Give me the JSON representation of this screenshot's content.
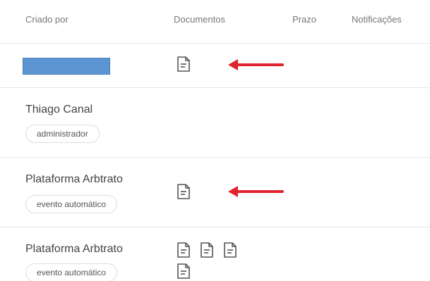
{
  "table": {
    "columns": {
      "created_by": "Criado por",
      "documents": "Documentos",
      "deadline": "Prazo",
      "notifications": "Notificações"
    },
    "rows": [
      {
        "creator": "",
        "tag": "",
        "documents": 1
      },
      {
        "creator": "Thiago Canal",
        "tag": "administrador",
        "documents": 0
      },
      {
        "creator": "Plataforma Arbtrato",
        "tag": "evento automático",
        "documents": 1
      },
      {
        "creator": "Plataforma Arbtrato",
        "tag": "evento automático",
        "documents": 4
      }
    ]
  },
  "annotations": {
    "arrow_color": "#e0242f"
  },
  "icons": {
    "document": "document-icon",
    "arrow": "arrow-left-icon"
  }
}
